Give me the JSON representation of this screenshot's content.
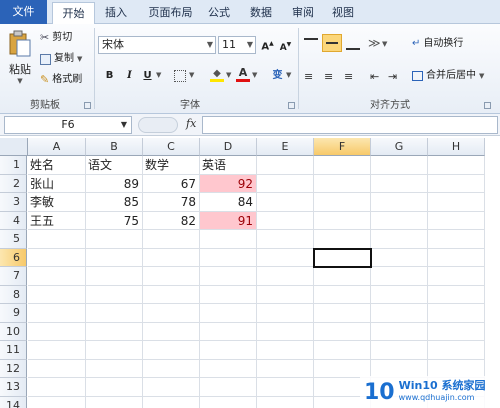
{
  "ribbon_tabs": [
    "文件",
    "开始",
    "插入",
    "页面布局",
    "公式",
    "数据",
    "审阅",
    "视图"
  ],
  "clipboard": {
    "paste": "粘贴",
    "cut": "剪切",
    "copy": "复制",
    "format_painter": "格式刷",
    "group_label": "剪贴板"
  },
  "font": {
    "name": "宋体",
    "size": "11",
    "group_label": "字体",
    "bold": "B",
    "italic": "I",
    "underline": "U",
    "phonetic": "变"
  },
  "alignment": {
    "wrap_text": "自动换行",
    "merge_center": "合并后居中",
    "group_label": "对齐方式"
  },
  "formula_bar": {
    "name_box": "F6",
    "fx": "fx",
    "value": ""
  },
  "sheet": {
    "columns": [
      "A",
      "B",
      "C",
      "D",
      "E",
      "F",
      "G",
      "H"
    ],
    "rows": [
      "1",
      "2",
      "3",
      "4",
      "5",
      "6",
      "7",
      "8",
      "9",
      "10",
      "11",
      "12",
      "13",
      "14"
    ],
    "selected_column": "F",
    "selected_row": "6",
    "data": [
      [
        "姓名",
        "语文",
        "数学",
        "英语"
      ],
      [
        "张山",
        "89",
        "67",
        "92"
      ],
      [
        "李敏",
        "85",
        "78",
        "84"
      ],
      [
        "王五",
        "75",
        "82",
        "91"
      ]
    ],
    "highlight_color": "#ffc7ce"
  },
  "watermark": {
    "logo": "10",
    "title": "Win10 系统家园",
    "url": "www.qdhuajin.com"
  }
}
